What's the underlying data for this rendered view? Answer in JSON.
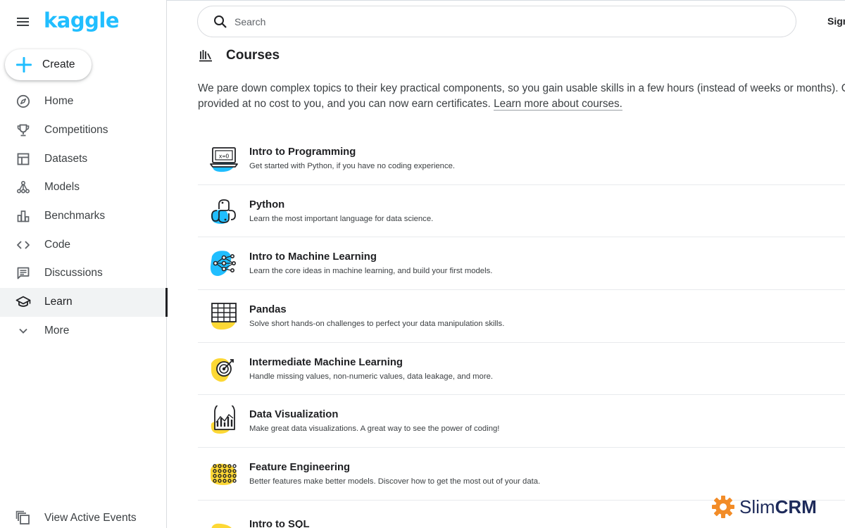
{
  "sidebar": {
    "logo": "kaggle",
    "create_label": "Create",
    "items": [
      {
        "label": "Home",
        "icon": "compass-icon"
      },
      {
        "label": "Competitions",
        "icon": "trophy-icon"
      },
      {
        "label": "Datasets",
        "icon": "table-icon"
      },
      {
        "label": "Models",
        "icon": "models-icon"
      },
      {
        "label": "Benchmarks",
        "icon": "bar-chart-icon"
      },
      {
        "label": "Code",
        "icon": "code-icon"
      },
      {
        "label": "Discussions",
        "icon": "comment-icon"
      },
      {
        "label": "Learn",
        "icon": "school-icon",
        "active": true
      },
      {
        "label": "More",
        "icon": "chevron-down-icon"
      }
    ],
    "events_label": "View Active Events"
  },
  "header": {
    "search_placeholder": "Search",
    "signin_label": "Sign In"
  },
  "main": {
    "title": "Courses",
    "intro_line1": "We pare down complex topics to their key practical components, so you gain usable skills in a few hours (instead of weeks or months). Courses are",
    "intro_line2_prefix": "provided at no cost to you, and you can now earn certificates. ",
    "intro_link": "Learn more about courses.",
    "courses": [
      {
        "title": "Intro to Programming",
        "description": "Get started with Python, if you have no coding experience.",
        "icon": "laptop-icon"
      },
      {
        "title": "Python",
        "description": "Learn the most important language for data science.",
        "icon": "python-icon"
      },
      {
        "title": "Intro to Machine Learning",
        "description": "Learn the core ideas in machine learning, and build your first models.",
        "icon": "network-icon"
      },
      {
        "title": "Pandas",
        "description": "Solve short hands-on challenges to perfect your data manipulation skills.",
        "icon": "grid-icon"
      },
      {
        "title": "Intermediate Machine Learning",
        "description": "Handle missing values, non-numeric values, data leakage, and more.",
        "icon": "target-icon"
      },
      {
        "title": "Data Visualization",
        "description": "Make great data visualizations. A great way to see the power of coding!",
        "icon": "chart-icon"
      },
      {
        "title": "Feature Engineering",
        "description": "Better features make better models. Discover how to get the most out of your data.",
        "icon": "dots-icon"
      },
      {
        "title": "Intro to SQL",
        "description": "",
        "icon": "database-icon"
      }
    ]
  },
  "watermark": {
    "slim": "Slim",
    "crm": "CRM"
  },
  "colors": {
    "brand": "#20beff",
    "blob_blue": "#20beff",
    "blob_yellow": "#fdd835",
    "text": "#202124"
  }
}
